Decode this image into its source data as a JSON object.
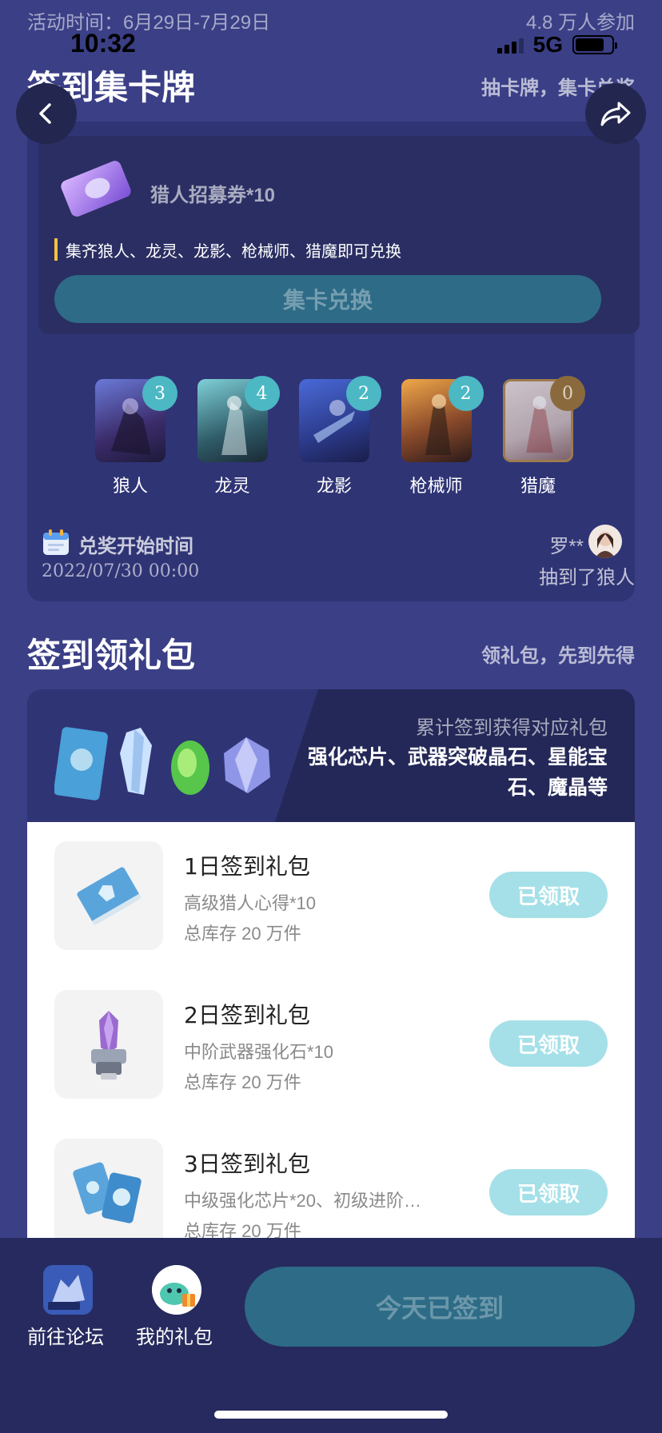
{
  "status_bar": {
    "activity_time": "活动时间：6月29日-7月29日",
    "participants": "4.8 万人参加",
    "clock": "10:32",
    "network": "5G"
  },
  "collect_section": {
    "title": "签到集卡牌",
    "subtitle": "抽卡牌，集卡兑奖",
    "reward_name": "猎人招募券*10",
    "rule": "集齐狼人、龙灵、龙影、枪械师、猎魔即可兑换",
    "exchange_button": "集卡兑换",
    "cards": [
      {
        "name": "狼人",
        "count": "3"
      },
      {
        "name": "龙灵",
        "count": "4"
      },
      {
        "name": "龙影",
        "count": "2"
      },
      {
        "name": "枪械师",
        "count": "2"
      },
      {
        "name": "猎魔",
        "count": "0"
      }
    ],
    "exchange_start_label": "兑奖开始时间",
    "exchange_start_time": "2022/07/30 00:00",
    "winner_name": "罗**",
    "winner_action": "抽到了狼人"
  },
  "gift_section": {
    "title": "签到领礼包",
    "subtitle": "领礼包，先到先得",
    "banner_sub": "累计签到获得对应礼包",
    "banner_desc": "强化芯片、武器突破晶石、星能宝石、魔晶等",
    "gifts": [
      {
        "name": "1日签到礼包",
        "content": "高级猎人心得*10",
        "stock": "总库存 20 万件",
        "button": "已领取"
      },
      {
        "name": "2日签到礼包",
        "content": "中阶武器强化石*10",
        "stock": "总库存 20 万件",
        "button": "已领取"
      },
      {
        "name": "3日签到礼包",
        "content": "中级强化芯片*20、初级进阶…",
        "stock": "总库存 20 万件",
        "button": "已领取"
      }
    ]
  },
  "bottom_bar": {
    "forum_label": "前往论坛",
    "my_gifts_label": "我的礼包",
    "sign_button": "今天已签到"
  }
}
